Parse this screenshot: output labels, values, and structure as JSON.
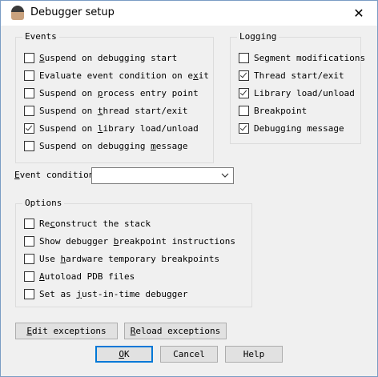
{
  "window": {
    "title": "Debugger setup",
    "close_symbol": "✕"
  },
  "events": {
    "legend": "Events",
    "items": [
      {
        "pre": "",
        "key": "S",
        "post": "uspend on debugging start",
        "checked": false
      },
      {
        "pre": "Evaluate event condition on e",
        "key": "x",
        "post": "it",
        "checked": false
      },
      {
        "pre": "Suspend on ",
        "key": "p",
        "post": "rocess entry point",
        "checked": false
      },
      {
        "pre": "Suspend on ",
        "key": "t",
        "post": "hread start/exit",
        "checked": false
      },
      {
        "pre": "Suspend on ",
        "key": "l",
        "post": "ibrary load/unload",
        "checked": true
      },
      {
        "pre": "Suspend on debugging ",
        "key": "m",
        "post": "essage",
        "checked": false
      }
    ]
  },
  "logging": {
    "legend": "Logging",
    "items": [
      {
        "pre": "Segment modifications",
        "key": "",
        "post": "",
        "checked": false
      },
      {
        "pre": "Thread start/exit",
        "key": "",
        "post": "",
        "checked": true
      },
      {
        "pre": "Library load/unload",
        "key": "",
        "post": "",
        "checked": true
      },
      {
        "pre": "Breakpoint",
        "key": "",
        "post": "",
        "checked": false
      },
      {
        "pre": "Debugging message",
        "key": "",
        "post": "",
        "checked": true
      }
    ]
  },
  "event_condition": {
    "pre": "",
    "key": "E",
    "post": "vent condition",
    "value": ""
  },
  "options": {
    "legend": "Options",
    "items": [
      {
        "pre": "Re",
        "key": "c",
        "post": "onstruct the stack",
        "checked": false
      },
      {
        "pre": "Show debugger ",
        "key": "b",
        "post": "reakpoint instructions",
        "checked": false
      },
      {
        "pre": "Use ",
        "key": "h",
        "post": "ardware temporary breakpoints",
        "checked": false
      },
      {
        "pre": "",
        "key": "A",
        "post": "utoload PDB files",
        "checked": false
      },
      {
        "pre": "Set as ",
        "key": "j",
        "post": "ust-in-time debugger",
        "checked": false
      }
    ]
  },
  "buttons": {
    "edit_exceptions": {
      "pre": "",
      "key": "E",
      "post": "dit exceptions"
    },
    "reload_exceptions": {
      "pre": "",
      "key": "R",
      "post": "eload exceptions"
    },
    "ok": {
      "pre": "",
      "key": "O",
      "post": "K"
    },
    "cancel": {
      "pre": "Cancel",
      "key": "",
      "post": ""
    },
    "help": {
      "pre": "Help",
      "key": "",
      "post": ""
    }
  },
  "icons": {
    "app": "app-avatar-icon",
    "dropdown": "chevron-down-icon",
    "close": "close-icon",
    "check": "checkmark-icon"
  }
}
